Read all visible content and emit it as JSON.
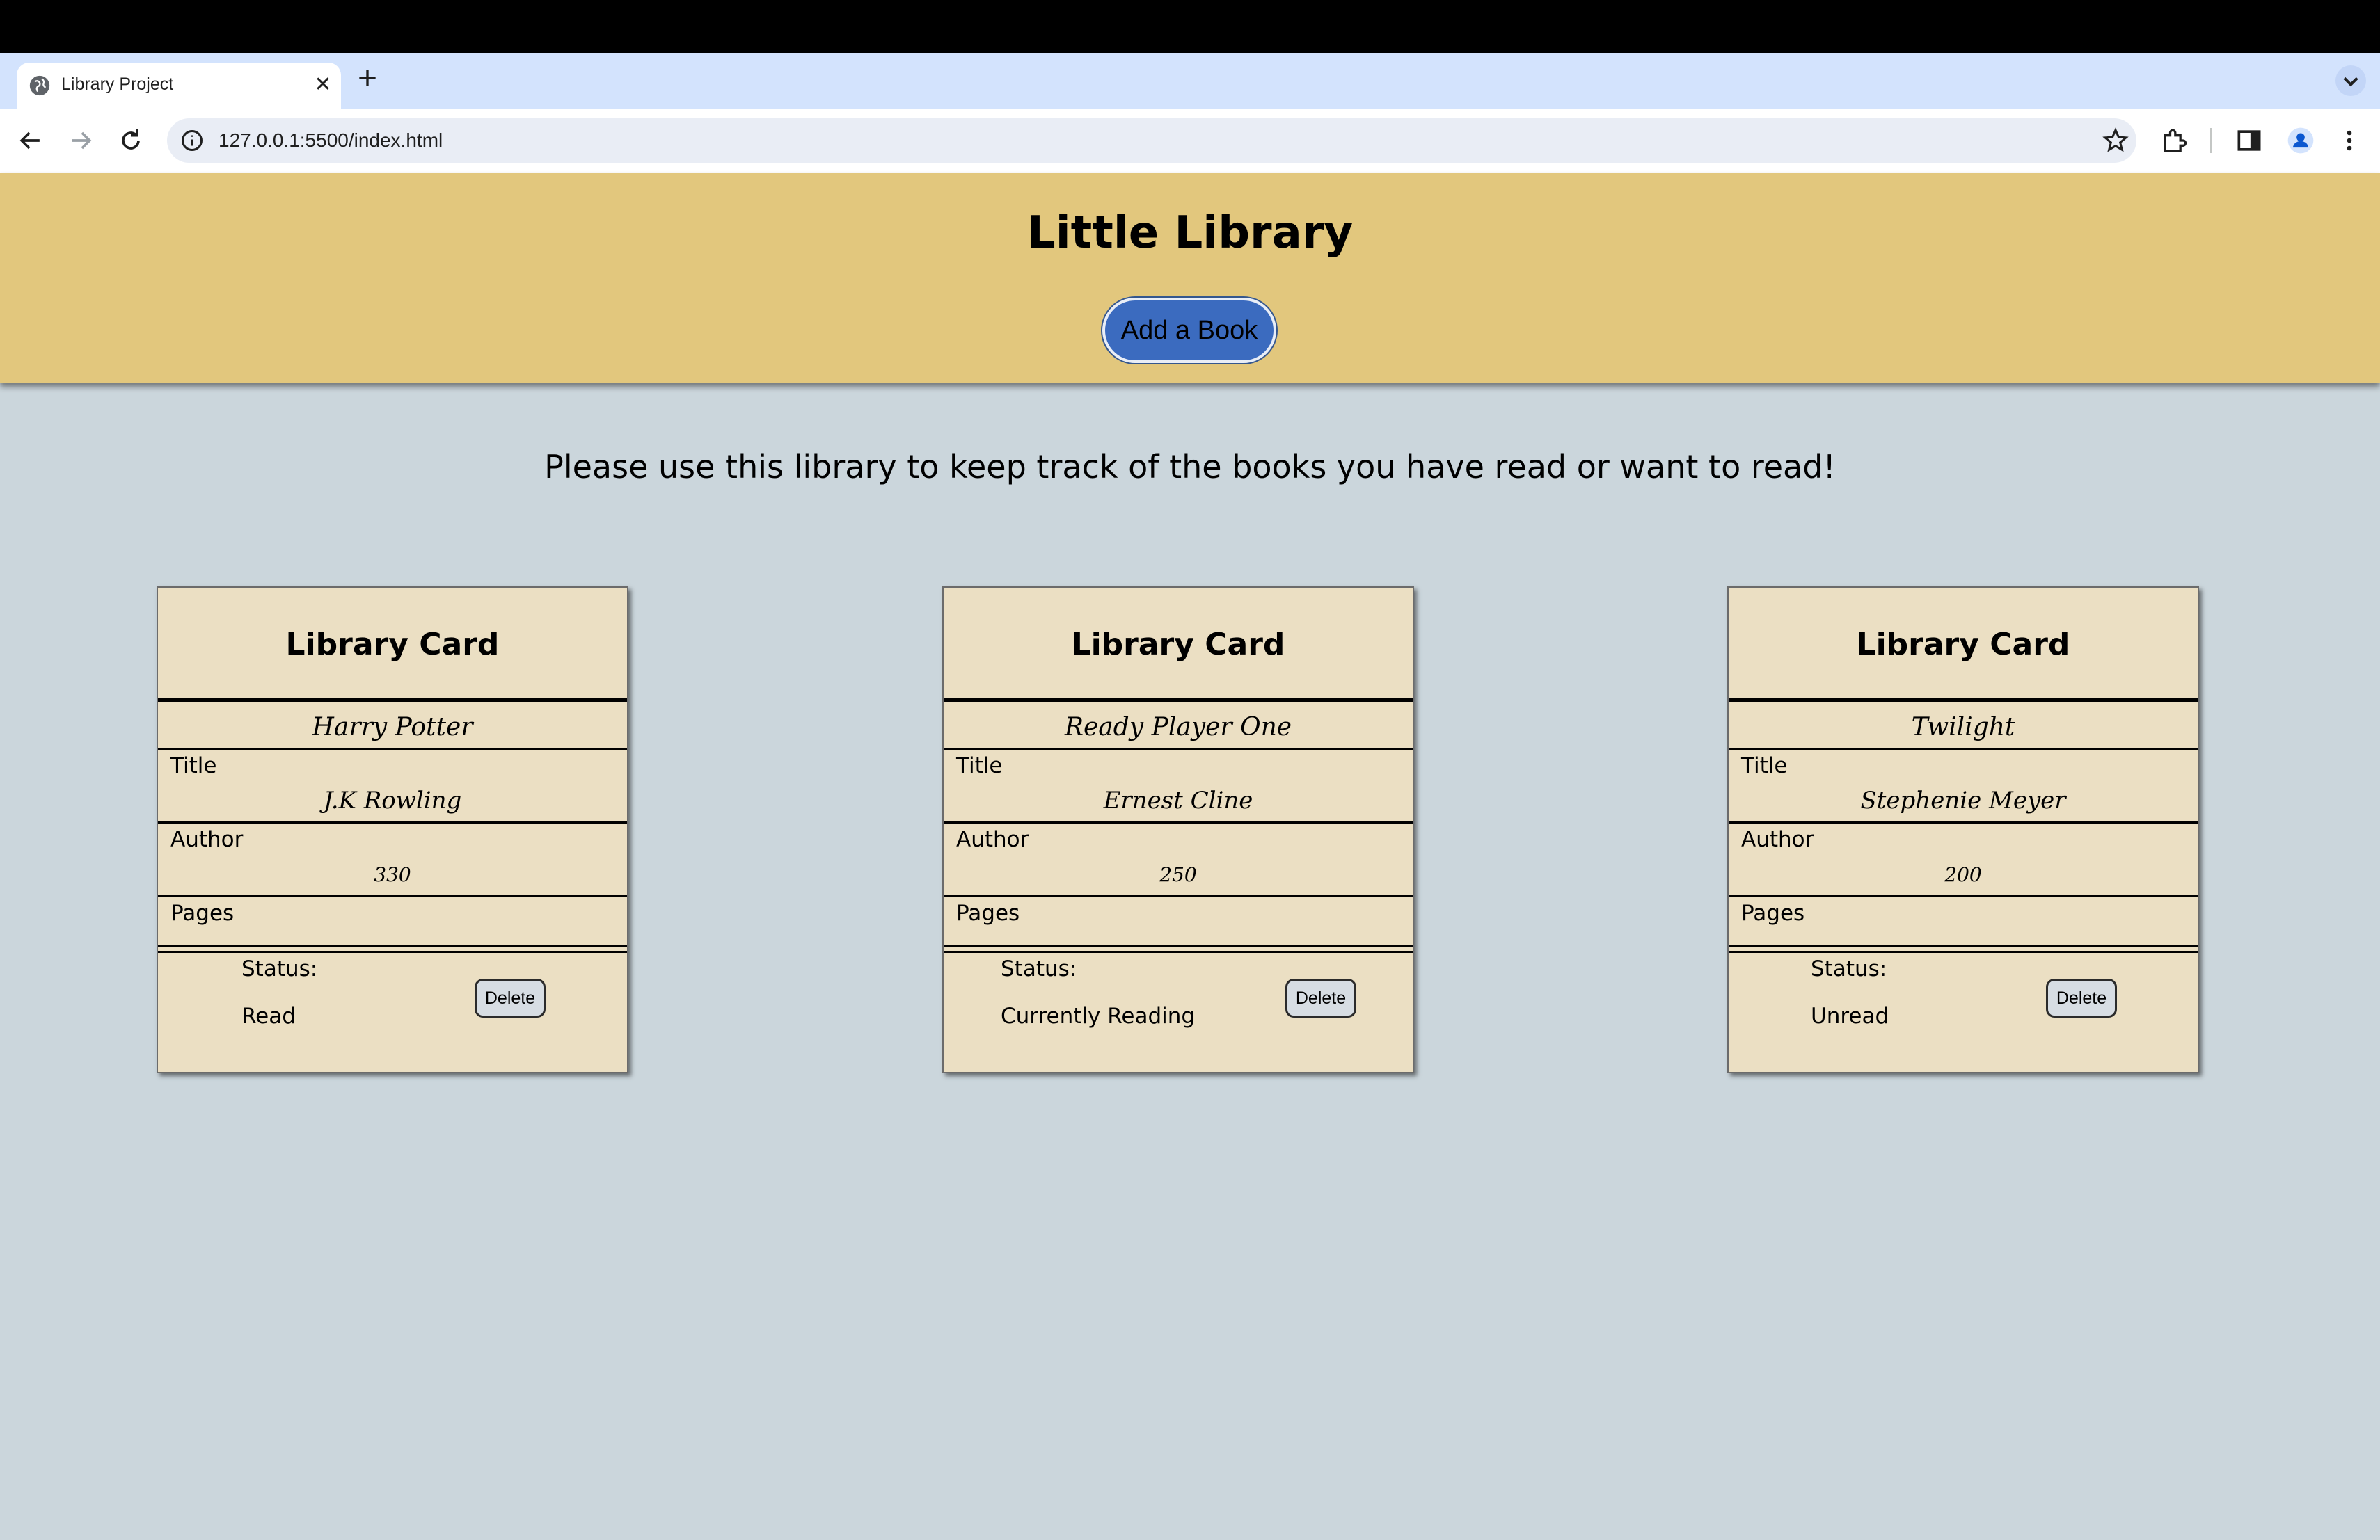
{
  "browser": {
    "tab_title": "Library Project",
    "tab_close_glyph": "✕",
    "url": "127.0.0.1:5500/index.html"
  },
  "header": {
    "title": "Little Library",
    "add_button_label": "Add a Book",
    "background_color": "#e2c77d",
    "button_color": "#3b6bbf"
  },
  "intro_text": "Please use this library to keep track of the books you have read or want to read!",
  "cards": [
    {
      "heading": "Library Card",
      "title_value": "Harry Potter",
      "title_label": "Title",
      "author_value": "J.K Rowling",
      "author_label": "Author",
      "pages_value": "330",
      "pages_label": "Pages",
      "status_label": "Status:",
      "status_value": "Read",
      "delete_label": "Delete"
    },
    {
      "heading": "Library Card",
      "title_value": "Ready Player One",
      "title_label": "Title",
      "author_value": "Ernest Cline",
      "author_label": "Author",
      "pages_value": "250",
      "pages_label": "Pages",
      "status_label": "Status:",
      "status_value": "Currently Reading",
      "delete_label": "Delete"
    },
    {
      "heading": "Library Card",
      "title_value": "Twilight",
      "title_label": "Title",
      "author_value": "Stephenie Meyer",
      "author_label": "Author",
      "pages_value": "200",
      "pages_label": "Pages",
      "status_label": "Status:",
      "status_value": "Unread",
      "delete_label": "Delete"
    }
  ]
}
